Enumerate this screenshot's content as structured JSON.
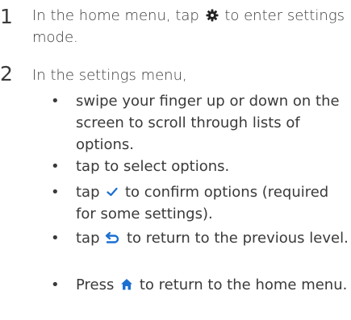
{
  "steps": [
    {
      "number": "1",
      "text_before": "In the home menu, tap",
      "icon": "gear-icon",
      "text_after": "to enter settings mode."
    },
    {
      "number": "2",
      "intro": "In the settings menu,",
      "bullets": [
        {
          "symbol": "•",
          "text": "swipe your finger up or down on the screen to scroll through lists of options."
        },
        {
          "symbol": "•",
          "text": "tap to select options."
        },
        {
          "symbol": "•",
          "text_before": "tap",
          "icon": "checkmark-icon",
          "text_after": "to confirm options (required for some settings)."
        },
        {
          "symbol": "•",
          "text_before": "tap",
          "icon": "back-arrow-icon",
          "text_after": "to return to the previous level."
        },
        {
          "symbol": "•",
          "text_before": "Press",
          "icon": "home-icon",
          "text_after": "to return to the home menu."
        }
      ]
    }
  ],
  "colors": {
    "text": "#3a3a3a",
    "icon_blue": "#1a6fd1"
  }
}
